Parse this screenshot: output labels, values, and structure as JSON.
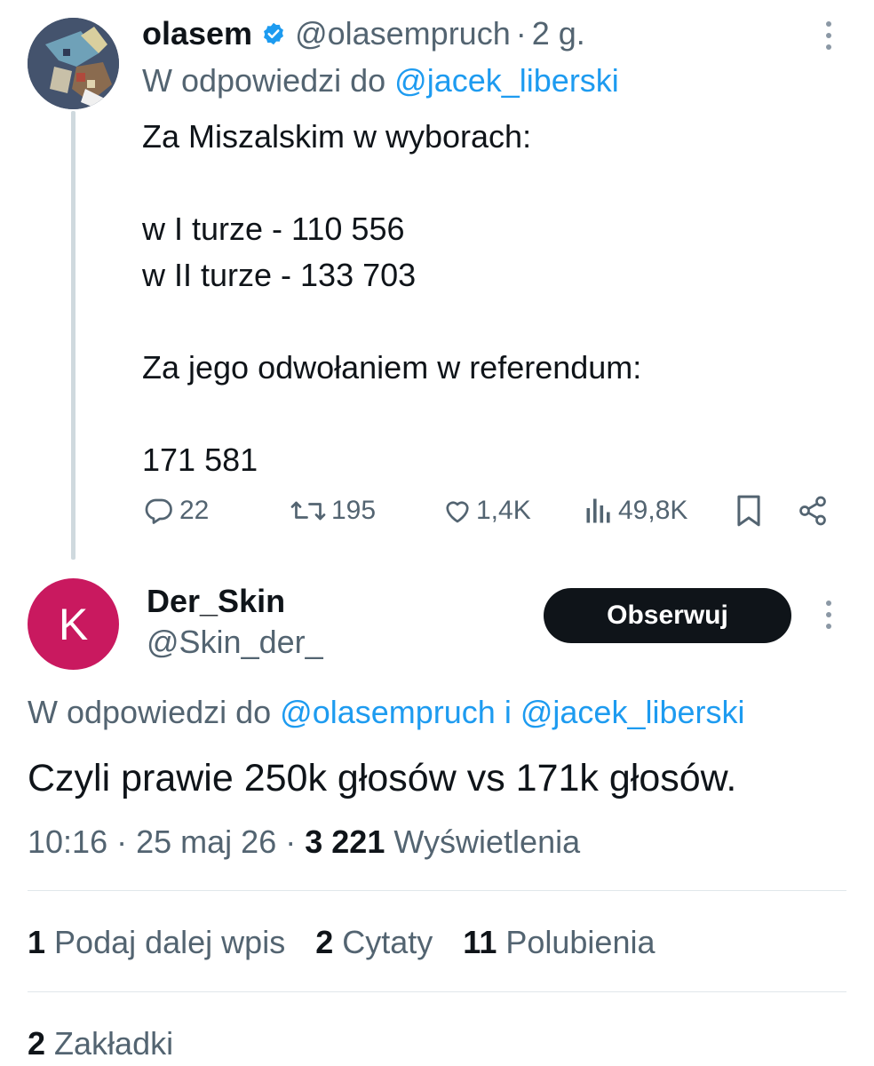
{
  "tweet1": {
    "display_name": "olasem",
    "handle": "@olasempruch",
    "separator": "·",
    "age": "2 g.",
    "reply_prefix": "W odpowiedzi do",
    "reply_to": "@jacek_liberski",
    "lines": [
      "Za Miszalskim w wyborach:",
      "",
      "w I turze - 110 556",
      "w II turze - 133 703",
      "",
      "Za jego odwołaniem w referendum:",
      "",
      "171 581"
    ],
    "actions": {
      "replies": "22",
      "reposts": "195",
      "likes": "1,4K",
      "views": "49,8K"
    },
    "icons": {
      "verified": "verified-badge-icon",
      "more": "more-options-icon",
      "reply": "reply-icon",
      "repost": "repost-icon",
      "like": "heart-icon",
      "views": "views-icon",
      "bookmark": "bookmark-icon",
      "share": "share-icon"
    }
  },
  "tweet2": {
    "avatar_letter": "K",
    "avatar_color": "#c9195f",
    "display_name": "Der_Skin",
    "handle": "@Skin_der_",
    "follow_label": "Obserwuj",
    "reply_prefix": "W odpowiedzi do",
    "reply_to_1": "@olasempruch",
    "reply_joiner": "i",
    "reply_to_2": "@jacek_liberski",
    "text": "Czyli prawie 250k głosów vs 171k głosów.",
    "time": "10:16",
    "separator": "·",
    "date": "25 maj 26",
    "views_count": "3 221",
    "views_label": "Wyświetlenia",
    "stats": {
      "reposts_count": "1",
      "reposts_label": "Podaj dalej wpis",
      "quotes_count": "2",
      "quotes_label": "Cytaty",
      "likes_count": "11",
      "likes_label": "Polubienia",
      "bookmarks_count": "2",
      "bookmarks_label": "Zakładki"
    }
  },
  "colors": {
    "link": "#1d9bf0",
    "muted": "#536471",
    "text": "#0f1419",
    "follow_button": "#0f1419"
  }
}
